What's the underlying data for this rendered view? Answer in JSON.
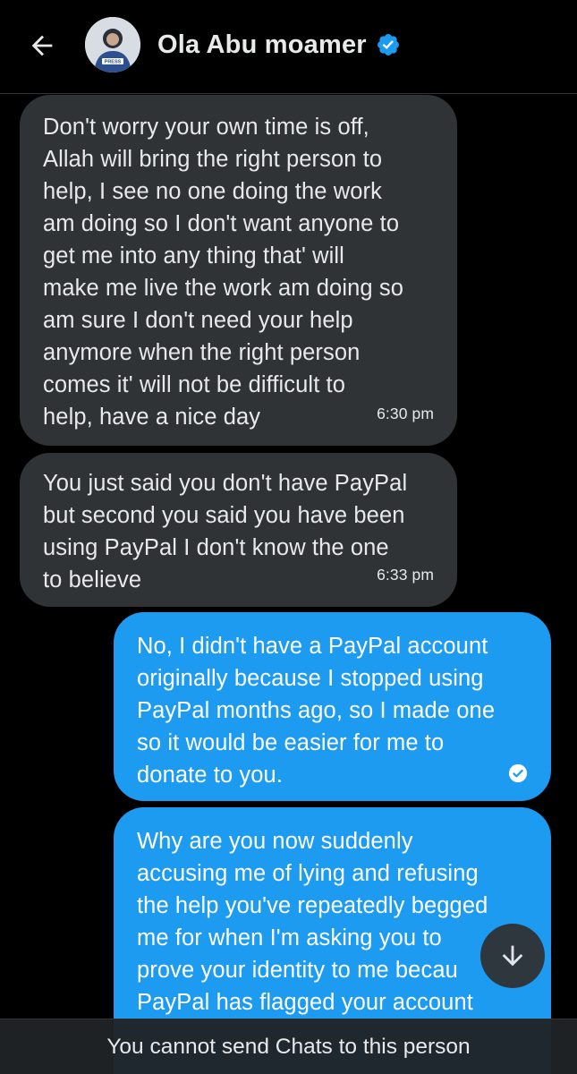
{
  "header": {
    "contact_name": "Ola Abu moamer",
    "avatar_badge_text": "PRESS",
    "verified_color": "#1d9bf0"
  },
  "messages": [
    {
      "direction": "incoming",
      "text": "Don't worry your own time is off,\nAllah will bring the right person to\nhelp, I see no one doing the work\nam doing so I don't want anyone to\nget me into any thing that' will\nmake me live the work am doing so\nam sure I don't need your help\nanymore when the right person\ncomes it' will not be difficult to\nhelp, have a nice day",
      "time": "6:30 pm"
    },
    {
      "direction": "incoming",
      "text": "You just said you don't have PayPal\nbut second you said you have been\nusing PayPal I don't know the one\nto believe",
      "time": "6:33 pm"
    },
    {
      "direction": "outgoing",
      "text": "No, I didn't have a PayPal account\noriginally because I stopped using\nPayPal months ago, so I made one\nso it would be easier for me to\ndonate to you.",
      "status_icon": "seen-check-icon"
    },
    {
      "direction": "outgoing",
      "text": "Why are you now suddenly\naccusing me of lying and refusing\nthe help you've repeatedly begged\nme for when I'm asking you to\nprove your identity to me becau\nPayPal has flagged your account"
    }
  ],
  "footer": {
    "notice": "You cannot send Chats to this person"
  },
  "colors": {
    "background": "#000000",
    "incoming_bubble": "#2f3336",
    "outgoing_bubble": "#1d9bf0"
  }
}
